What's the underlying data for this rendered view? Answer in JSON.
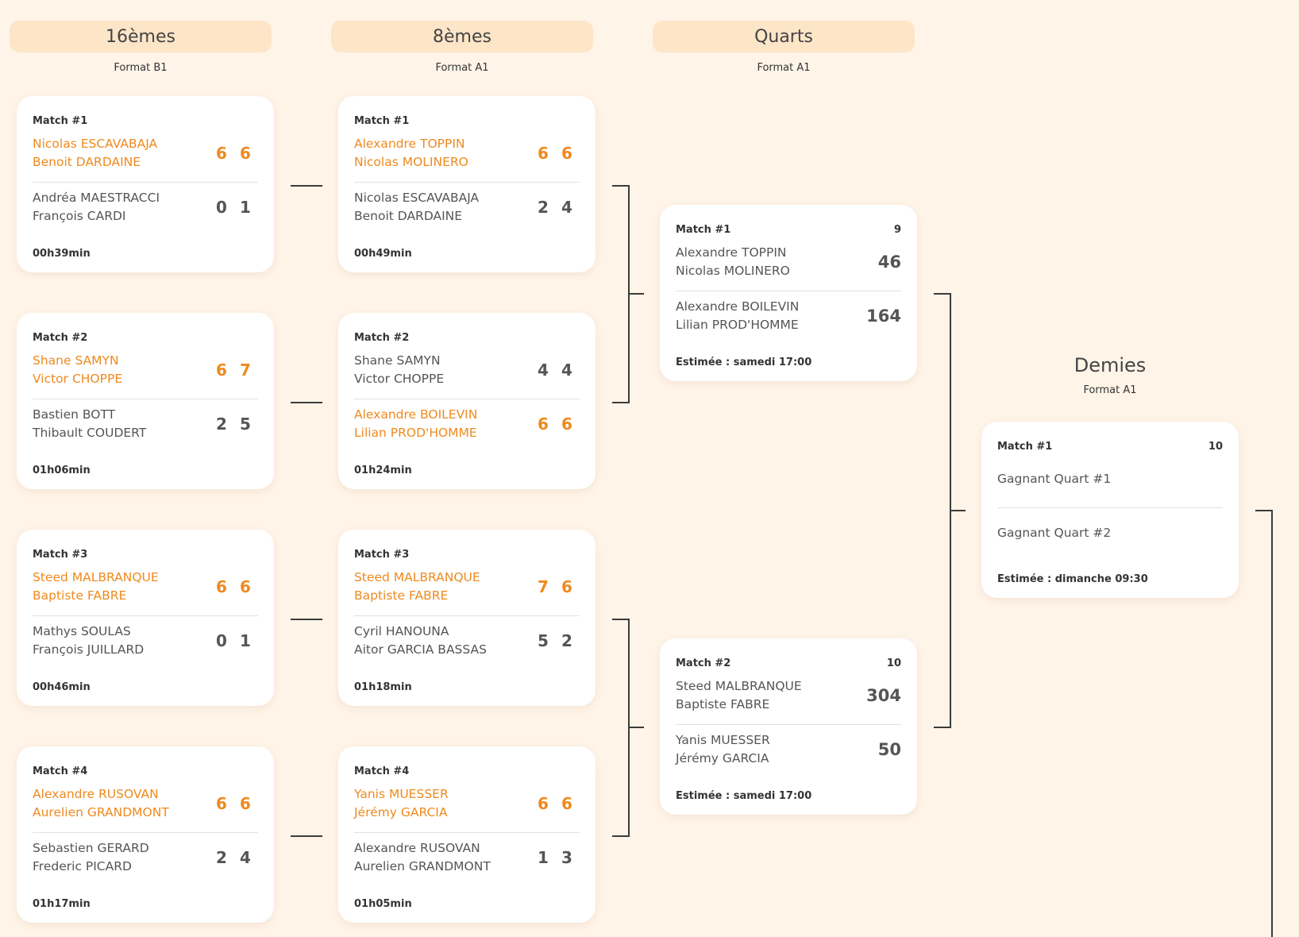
{
  "rounds": {
    "r16": {
      "title": "16èmes",
      "format": "Format B1"
    },
    "r8": {
      "title": "8èmes",
      "format": "Format A1"
    },
    "quarts": {
      "title": "Quarts",
      "format": "Format A1"
    },
    "demies": {
      "title": "Demies",
      "format": "Format A1"
    }
  },
  "r16": [
    {
      "label": "Match #1",
      "t1": {
        "p1": "Nicolas ESCAVABAJA",
        "p2": "Benoit DARDAINE",
        "s": [
          "6",
          "6"
        ]
      },
      "t2": {
        "p1": "Andréa MAESTRACCI",
        "p2": "François CARDI",
        "s": [
          "0",
          "1"
        ]
      },
      "foot": "00h39min"
    },
    {
      "label": "Match #2",
      "t1": {
        "p1": "Shane SAMYN",
        "p2": "Victor CHOPPE",
        "s": [
          "6",
          "7"
        ]
      },
      "t2": {
        "p1": "Bastien BOTT",
        "p2": "Thibault COUDERT",
        "s": [
          "2",
          "5"
        ]
      },
      "foot": "01h06min"
    },
    {
      "label": "Match #3",
      "t1": {
        "p1": "Steed MALBRANQUE",
        "p2": "Baptiste FABRE",
        "s": [
          "6",
          "6"
        ]
      },
      "t2": {
        "p1": "Mathys SOULAS",
        "p2": "François JUILLARD",
        "s": [
          "0",
          "1"
        ]
      },
      "foot": "00h46min"
    },
    {
      "label": "Match #4",
      "t1": {
        "p1": "Alexandre RUSOVAN",
        "p2": "Aurelien GRANDMONT",
        "s": [
          "6",
          "6"
        ]
      },
      "t2": {
        "p1": "Sebastien GERARD",
        "p2": "Frederic PICARD",
        "s": [
          "2",
          "4"
        ]
      },
      "foot": "01h17min"
    }
  ],
  "r8": [
    {
      "label": "Match #1",
      "t1": {
        "p1": "Alexandre TOPPIN",
        "p2": "Nicolas MOLINERO",
        "s": [
          "6",
          "6"
        ]
      },
      "t2": {
        "p1": "Nicolas ESCAVABAJA",
        "p2": "Benoit DARDAINE",
        "s": [
          "2",
          "4"
        ]
      },
      "foot": "00h49min"
    },
    {
      "label": "Match #2",
      "t1": {
        "p1": "Shane SAMYN",
        "p2": "Victor CHOPPE",
        "s": [
          "4",
          "4"
        ]
      },
      "t2": {
        "p1": "Alexandre BOILEVIN",
        "p2": "Lilian PROD'HOMME",
        "s": [
          "6",
          "6"
        ]
      },
      "foot": "01h24min"
    },
    {
      "label": "Match #3",
      "t1": {
        "p1": "Steed MALBRANQUE",
        "p2": "Baptiste FABRE",
        "s": [
          "7",
          "6"
        ]
      },
      "t2": {
        "p1": "Cyril HANOUNA",
        "p2": "Aitor GARCIA BASSAS",
        "s": [
          "5",
          "2"
        ]
      },
      "foot": "01h18min"
    },
    {
      "label": "Match #4",
      "t1": {
        "p1": "Yanis MUESSER",
        "p2": "Jérémy GARCIA",
        "s": [
          "6",
          "6"
        ]
      },
      "t2": {
        "p1": "Alexandre RUSOVAN",
        "p2": "Aurelien GRANDMONT",
        "s": [
          "1",
          "3"
        ]
      },
      "foot": "01h05min"
    }
  ],
  "quarts": [
    {
      "label": "Match #1",
      "num": "9",
      "t1": {
        "p1": "Alexandre TOPPIN",
        "p2": "Nicolas MOLINERO",
        "total": "46"
      },
      "t2": {
        "p1": "Alexandre BOILEVIN",
        "p2": "Lilian PROD'HOMME",
        "total": "164"
      },
      "foot": "Estimée : samedi 17:00"
    },
    {
      "label": "Match #2",
      "num": "10",
      "t1": {
        "p1": "Steed MALBRANQUE",
        "p2": "Baptiste FABRE",
        "total": "304"
      },
      "t2": {
        "p1": "Yanis MUESSER",
        "p2": "Jérémy GARCIA",
        "total": "50"
      },
      "foot": "Estimée : samedi 17:00"
    }
  ],
  "demies": [
    {
      "label": "Match #1",
      "num": "10",
      "t1": "Gagnant Quart #1",
      "t2": "Gagnant Quart #2",
      "foot": "Estimée : dimanche 09:30"
    }
  ],
  "colors": {
    "accent": "#ee8a1f",
    "background": "#fff4e8",
    "header": "#fde5c8"
  }
}
